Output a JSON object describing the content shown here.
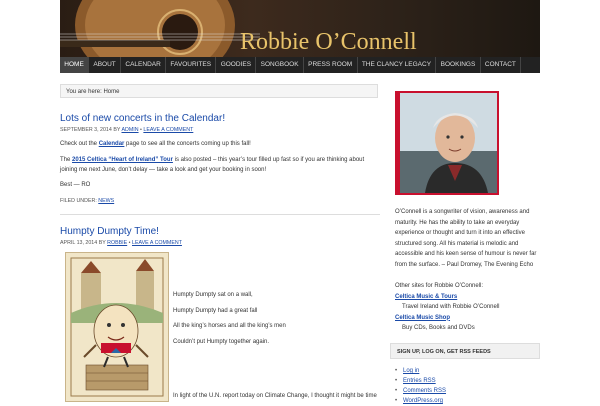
{
  "site": {
    "title": "Robbie O’Connell"
  },
  "nav": [
    {
      "label": "Home",
      "active": true
    },
    {
      "label": "About"
    },
    {
      "label": "Calendar"
    },
    {
      "label": "Favourites"
    },
    {
      "label": "Goodies"
    },
    {
      "label": "Songbook"
    },
    {
      "label": "Press Room"
    },
    {
      "label": "The Clancy Legacy"
    },
    {
      "label": "Bookings"
    },
    {
      "label": "Contact"
    }
  ],
  "breadcrumb": "You are here: Home",
  "posts": [
    {
      "title": "Lots of new concerts in the Calendar!",
      "date": "September 3, 2014",
      "by": "by",
      "author": "Admin",
      "comment": "Leave a Comment",
      "p1_pre": "Check out the ",
      "p1_link": "Calendar",
      "p1_post": " page to see all the concerts coming up this fall!",
      "p2_link": "2015 Celtica “Heart of Ireland” Tour",
      "p2_post": " is also posted – this year’s tour filled up fast so if you are thinking about joining me next June, don’t delay — take a look and get your booking in soon!",
      "p2_pre": "The ",
      "signoff": "Best — RO",
      "filed_label": "Filed Under:",
      "filed_cat": "News"
    },
    {
      "title": "Humpty Dumpty Time!",
      "date": "April 13, 2014",
      "by": "by",
      "author": "Robbie",
      "comment": "Leave a Comment",
      "lines": [
        "Humpty Dumpty sat on a wall,",
        "Humpty Dumpty had a great fall",
        "All the king’s horses and all the king’s men",
        "Couldn’t put Humpty together again."
      ],
      "trailing": "In light of the U.N. report today on Climate Change, I thought it might be time"
    }
  ],
  "sidebar": {
    "bio": "O’Connell is a songwriter of vision, awareness and maturity. He has the ability to take an everyday experience or thought and turn it into an effective structured song. All his material is melodic and accessible and his keen sense of humour is never far from the surface. – Paul Dromey, The Evening Echo",
    "other_sites_label": "Other sites for Robbie O’Connell:",
    "links": [
      {
        "name": "Celtica Music & Tours",
        "desc": "Travel Ireland with Robbie O’Connell"
      },
      {
        "name": "Celtica Music Shop",
        "desc": "Buy CDs, Books and DVDs"
      }
    ],
    "box_title": "Sign up, log on, get RSS feeds",
    "box_items": [
      "Log in",
      "Entries RSS",
      "Comments RSS",
      "WordPress.org"
    ]
  },
  "colors": {
    "accent_red": "#c8102e",
    "link_blue": "#1a4aa8",
    "title_gold": "#e8c36a",
    "nav_bg": "#222222"
  }
}
